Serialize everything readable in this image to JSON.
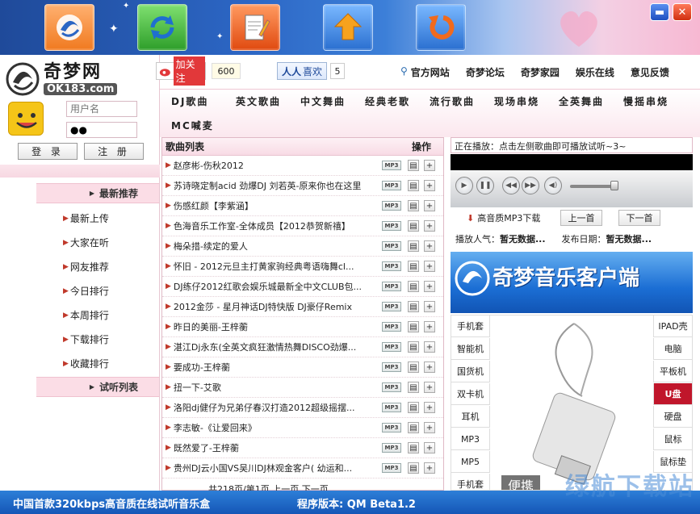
{
  "colors": {
    "accent": "#2c66c4",
    "pink": "#fbdde6",
    "active_red": "#c0162b"
  },
  "top_icons": [
    "swirl-logo-icon",
    "refresh-icon",
    "notepad-icon",
    "upload-arrow-icon",
    "rotate-arrow-icon"
  ],
  "logo": {
    "name": "奇梦网",
    "domain": "OK183.com"
  },
  "login": {
    "username_placeholder": "用户名",
    "password_value": "●●",
    "login_label": "登 录",
    "register_label": "注 册"
  },
  "nav": {
    "latest_recommend": "最新推荐",
    "items": [
      "最新上传",
      "大家在听",
      "网友推荐",
      "今日排行",
      "本周排行",
      "下载排行",
      "收藏排行"
    ],
    "listen_list": "试听列表"
  },
  "social": {
    "weibo_label": "加关注",
    "weibo_count": "600",
    "xihuan_label": "喜欢",
    "xihuan_count": "5"
  },
  "toplinks": [
    "官方网站",
    "奇梦论坛",
    "奇梦家园",
    "娱乐在线",
    "意见反馈"
  ],
  "genres": [
    "DJ歌曲",
    "英文歌曲",
    "中文舞曲",
    "经典老歌",
    "流行歌曲",
    "现场串烧",
    "全英舞曲",
    "慢摇串烧",
    "MC喊麦"
  ],
  "songlist": {
    "header_title": "歌曲列表",
    "header_ops": "操作",
    "mp3_badge": "MP3",
    "songs": [
      "赵彦彬-伤秋2012",
      "苏诗晓定制acid 劲爆DJ 刘若英-原来你也在这里",
      "伤感红颜【李紫涵】",
      "色海音乐工作室-全体成员【2012恭贺新禧】",
      "梅朵措-续定的爱人",
      "怀旧 - 2012元旦主打黄家驹经典粤语嗨舞cl...",
      "DJ练仔2012红歌会娱乐城最新全中文CLUB包...",
      "2012金莎 - 星月神话DJ特快版 DJ豪仔Remix",
      "昨日的美丽-王梓蘅",
      "湛江Dj永东(全英文疯狂激情热舞DISCO劲爆...",
      "要成功-王梓蘅",
      "扭一下-艾歌",
      "洛阳dj健仔为兄弟仔春汉打造2012超级摇摆...",
      "李志敏-《让爱回来》",
      "既然爱了-王梓蘅",
      "贵州DJ云小国VS吴川DJ林观金客户( 幼运和..."
    ],
    "pager": "共218页/第1页    上一页    下一页"
  },
  "player": {
    "now_playing": "正在播放：点击左侧歌曲即可播放试听~3~",
    "download_label": "高音质MP3下载",
    "prev_label": "上一首",
    "next_label": "下一首",
    "popularity_label": "播放人气：",
    "popularity_value": "暂无数据...",
    "date_label": "发布日期：",
    "date_value": "暂无数据..."
  },
  "client_banner": "奇梦音乐客户端",
  "ad": {
    "left_cats": [
      "手机套",
      "智能机",
      "国货机",
      "双卡机",
      "耳机",
      "MP3",
      "MP5",
      "手机套"
    ],
    "right_cats": [
      "IPAD壳",
      "电脑",
      "平板机",
      "U盘",
      "硬盘",
      "鼠标",
      "鼠标垫"
    ],
    "active_right": 3,
    "caption": "便携"
  },
  "bottom": {
    "slogan": "中国首款320kbps高音质在线试听音乐盒",
    "version": "程序版本: QM Beta1.2"
  },
  "watermark": "绿航下载站"
}
